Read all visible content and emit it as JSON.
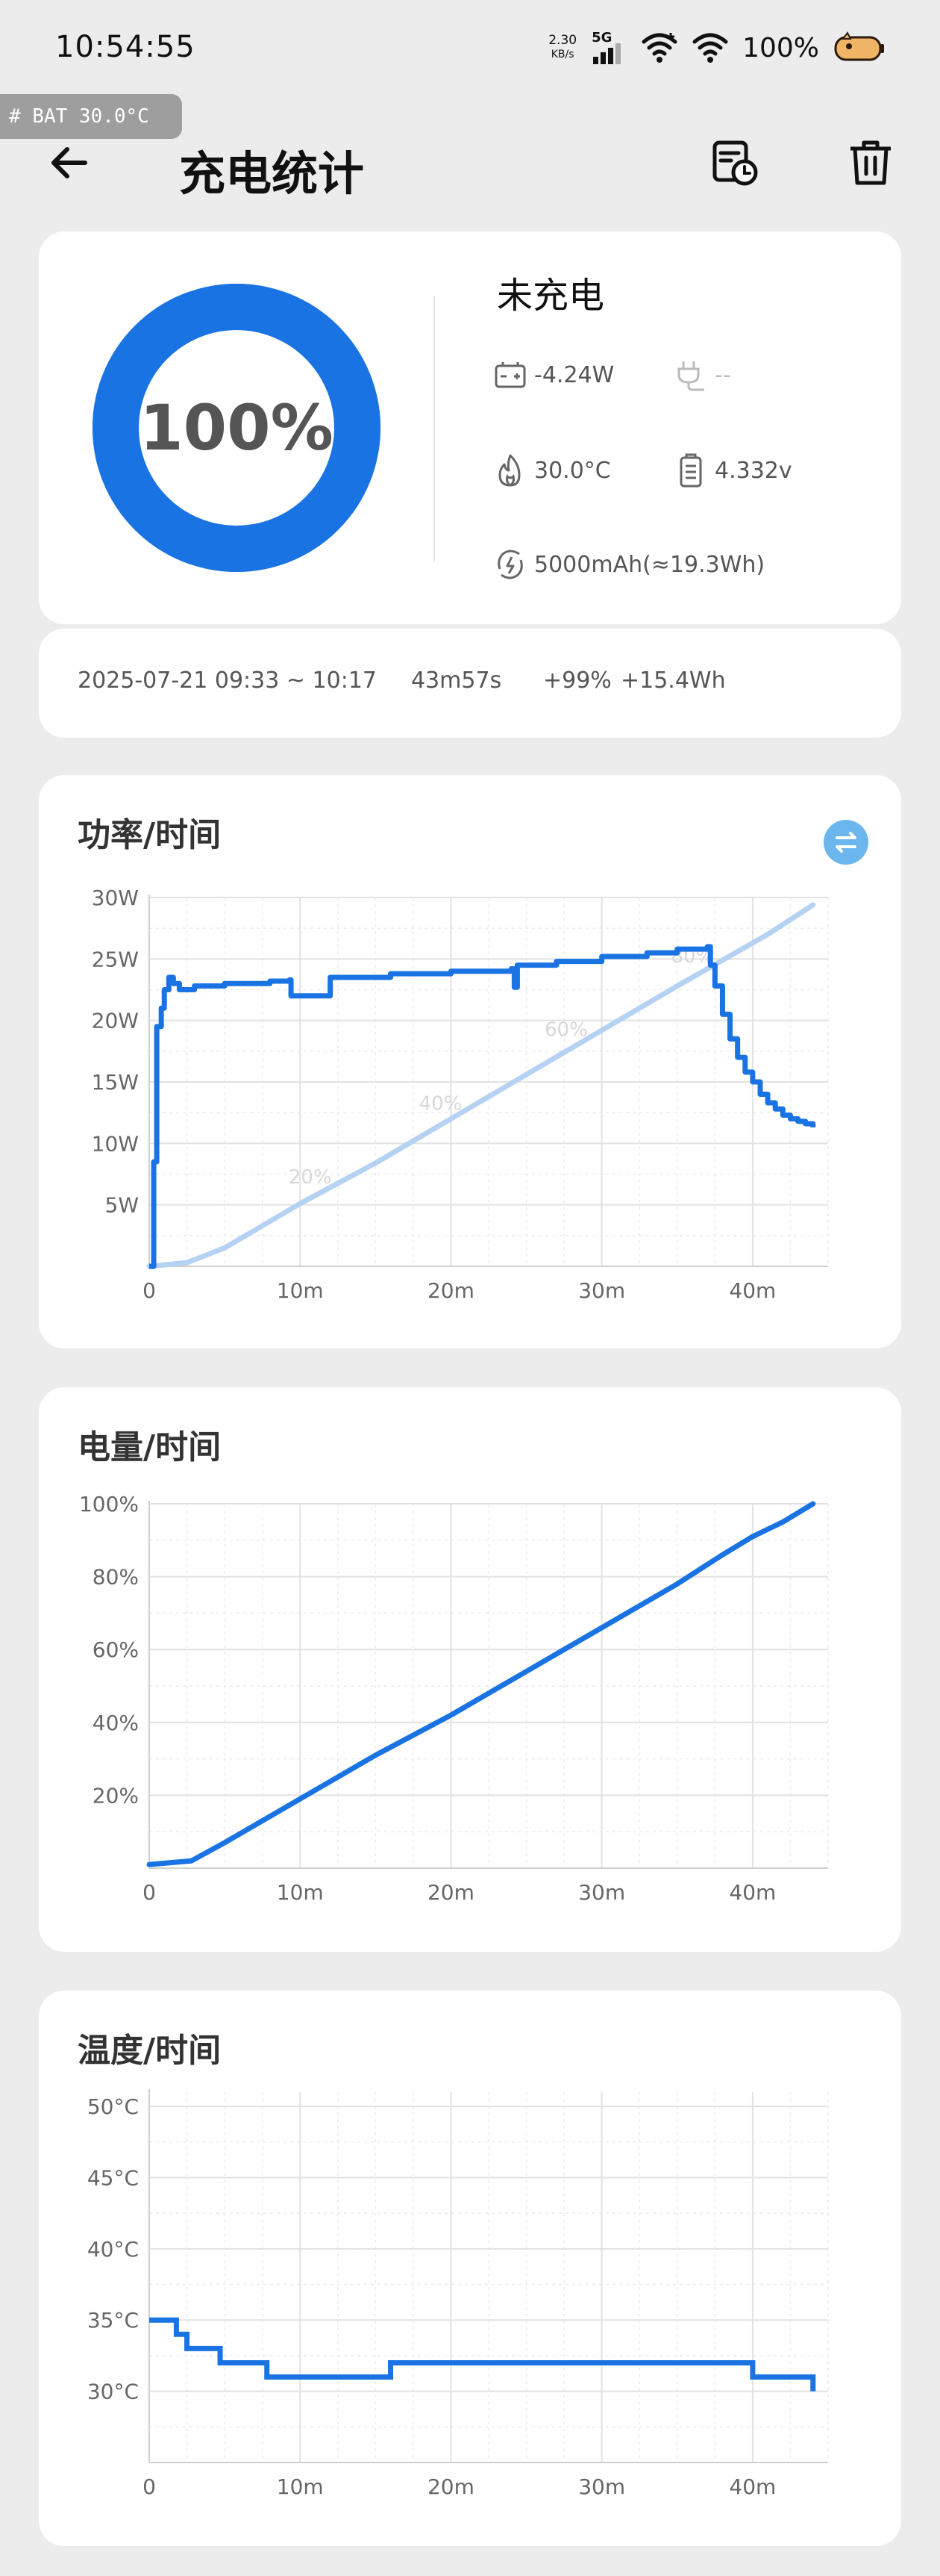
{
  "status_bar": {
    "time": "10:54:55",
    "net_speed_value": "2.30",
    "net_speed_unit": "KB/s",
    "network_type": "5G",
    "battery_percent": "100%",
    "icons": [
      "signal-icon",
      "wifi-plus-icon",
      "wifi-icon",
      "battery-fox-icon"
    ]
  },
  "debug_tag": "# BAT 30.0°C",
  "header": {
    "title": "充电统计",
    "back_icon": "arrow-left-icon",
    "history_icon": "calendar-clock-icon",
    "delete_icon": "trash-icon"
  },
  "overview": {
    "level_percent": 100,
    "level_text": "100%",
    "status": "未充电",
    "power": "-4.24W",
    "charger": "--",
    "temperature": "30.0°C",
    "voltage": "4.332v",
    "capacity": "5000mAh(≈19.3Wh)",
    "colors": {
      "ring": "#1a73e2",
      "ring_track": "#1a73e2"
    }
  },
  "session": {
    "range": "2025-07-21 09:33 ~ 10:17",
    "duration": "43m57s",
    "percent_gain": "+99%",
    "energy_gain": "+15.4Wh"
  },
  "chart_data": [
    {
      "type": "line",
      "title": "功率/时间",
      "x_tick_labels": [
        "0",
        "10m",
        "20m",
        "30m",
        "40m"
      ],
      "y_tick_labels": [
        "5W",
        "10W",
        "15W",
        "20W",
        "25W",
        "30W"
      ],
      "xlim": [
        0,
        45
      ],
      "ylim": [
        0,
        30
      ],
      "grid": true,
      "overlay_percent_labels": [
        "20%",
        "40%",
        "60%",
        "80%"
      ],
      "series": [
        {
          "color": "#1a73e2",
          "unit": "W",
          "x": [
            0,
            0.3,
            0.5,
            0.8,
            1,
            1.3,
            1.6,
            2,
            3,
            5,
            8,
            9.3,
            9.4,
            12,
            16,
            20,
            24,
            24.2,
            24.4,
            27,
            30,
            33,
            35,
            37,
            37.2,
            37.5,
            38,
            38.5,
            39,
            39.5,
            40,
            40.5,
            41,
            41.5,
            42,
            42.5,
            43,
            43.5,
            44
          ],
          "y": [
            0,
            8.5,
            19.5,
            21,
            22.5,
            23.5,
            23,
            22.5,
            22.8,
            23,
            23.2,
            23.3,
            22,
            23.5,
            23.8,
            24,
            24.2,
            22.7,
            24.5,
            24.8,
            25.2,
            25.5,
            25.8,
            26,
            24.5,
            22.8,
            20.5,
            18.5,
            17,
            15.8,
            15,
            14,
            13.3,
            12.8,
            12.3,
            12,
            11.8,
            11.6,
            11.3
          ]
        },
        {
          "color": "#b6d2f2",
          "unit": "%",
          "x": [
            0,
            2.5,
            5,
            10,
            15,
            20,
            25,
            30,
            35,
            38,
            41,
            44
          ],
          "y": [
            0,
            1,
            5,
            17,
            28,
            40,
            52,
            64,
            76,
            83,
            90,
            98
          ]
        }
      ]
    },
    {
      "type": "line",
      "title": "电量/时间",
      "x_tick_labels": [
        "0",
        "10m",
        "20m",
        "30m",
        "40m"
      ],
      "y_tick_labels": [
        "20%",
        "40%",
        "60%",
        "80%",
        "100%"
      ],
      "xlim": [
        0,
        45
      ],
      "ylim": [
        0,
        100
      ],
      "grid": true,
      "series": [
        {
          "color": "#1a73e2",
          "x": [
            0,
            2.8,
            5,
            10,
            15,
            20,
            25,
            30,
            35,
            38,
            40,
            42,
            44
          ],
          "y": [
            1,
            2,
            7,
            19,
            31,
            42,
            54,
            66,
            78,
            86,
            91,
            95,
            100
          ]
        }
      ]
    },
    {
      "type": "line",
      "title": "温度/时间",
      "x_tick_labels": [
        "0",
        "10m",
        "20m",
        "30m",
        "40m"
      ],
      "y_tick_labels": [
        "30°C",
        "35°C",
        "40°C",
        "45°C",
        "50°C"
      ],
      "xlim": [
        0,
        45
      ],
      "ylim": [
        25,
        51
      ],
      "grid": true,
      "series": [
        {
          "color": "#1a73e2",
          "x": [
            0,
            1.8,
            1.8,
            2.5,
            2.5,
            4.7,
            4.7,
            7.8,
            7.8,
            16,
            16,
            40,
            40,
            44,
            44
          ],
          "y": [
            35,
            35,
            34,
            34,
            33,
            33,
            32,
            32,
            31,
            31,
            32,
            32,
            31,
            31,
            30
          ]
        }
      ]
    }
  ]
}
